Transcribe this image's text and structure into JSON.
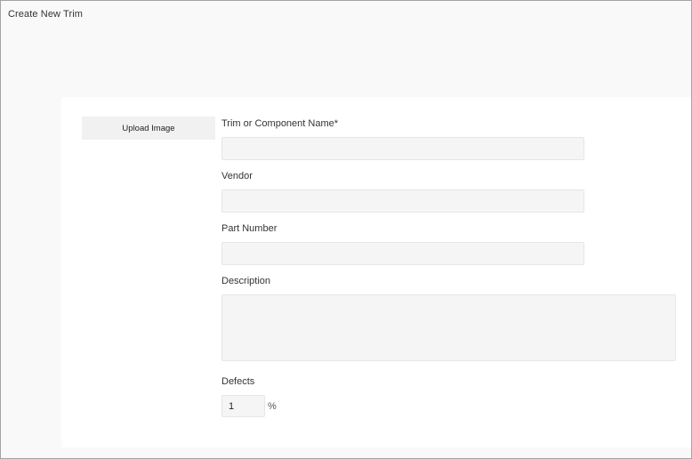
{
  "window": {
    "title": "Create New Trim"
  },
  "form": {
    "upload_button": "Upload Image",
    "name_label": "Trim or Component Name*",
    "name_value": "",
    "vendor_label": "Vendor",
    "vendor_value": "",
    "part_number_label": "Part Number",
    "part_number_value": "",
    "description_label": "Description",
    "description_value": "",
    "defects_label": "Defects",
    "defects_value": "1",
    "defects_unit": "%"
  }
}
